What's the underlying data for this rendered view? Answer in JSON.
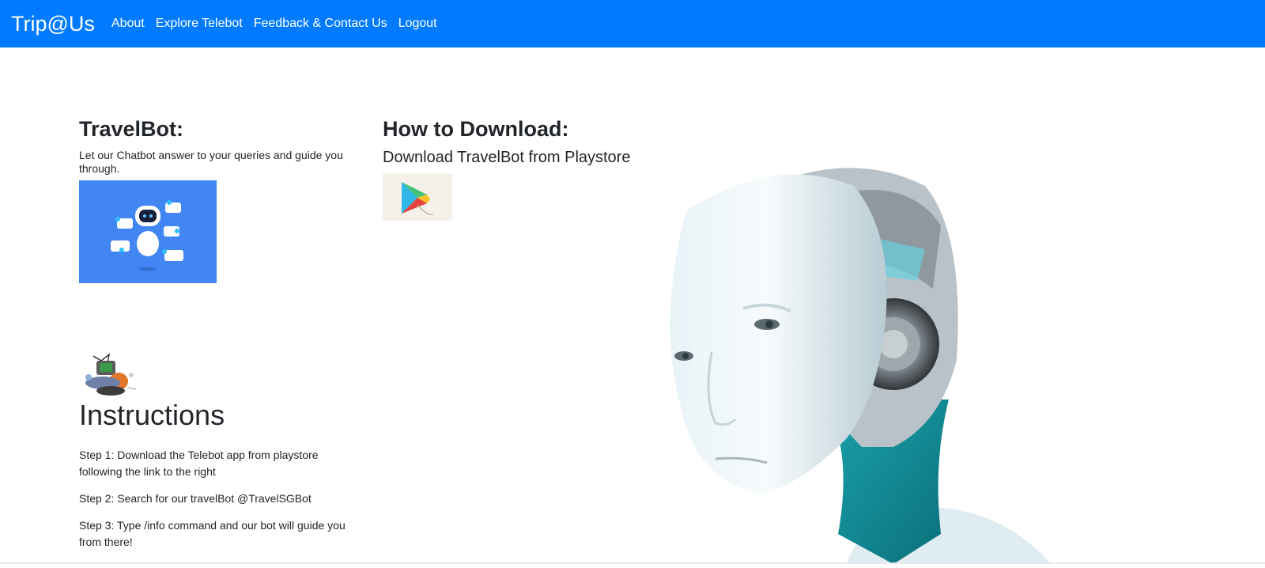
{
  "navbar": {
    "brand": "Trip@Us",
    "links": [
      "About",
      "Explore Telebot",
      "Feedback & Contact Us",
      "Logout"
    ],
    "background": "#007bff"
  },
  "travelbot": {
    "title": "TravelBot:",
    "description": "Let our Chatbot answer to your queries and guide you through."
  },
  "download": {
    "title": "How to Download:",
    "subtitle": "Download TravelBot from Playstore"
  },
  "instructions": {
    "title": "Instructions",
    "steps": [
      "Step 1: Download the Telebot app from playstore following the link to the right",
      "Step 2: Search for our travelBot @TravelSGBot",
      "Step 3: Type /info command and our bot will guide you from there!"
    ]
  },
  "icons": {
    "chatbot": "chatbot-robot-icon",
    "playstore": "google-play-icon",
    "gamer": "gamer-illustration",
    "robot": "humanoid-robot-illustration"
  }
}
